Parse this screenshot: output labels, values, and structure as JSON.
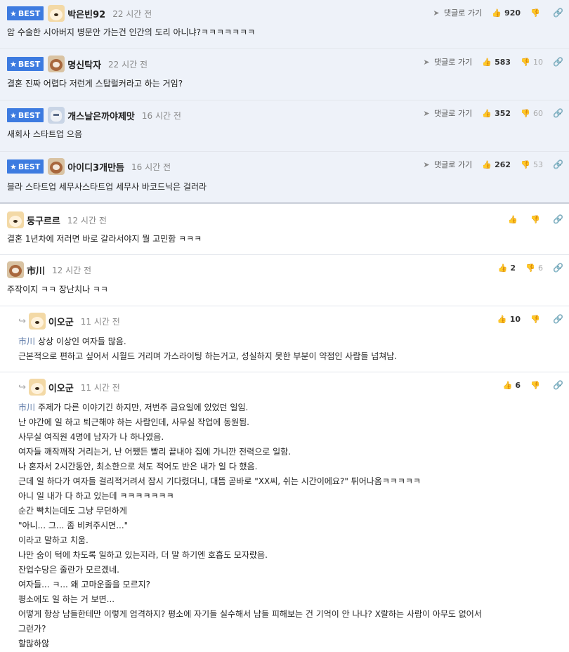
{
  "labels": {
    "best": "BEST",
    "goto_reply": "댓글로 가기"
  },
  "comments": [
    {
      "type": "best",
      "nickname": "박은빈92",
      "time": "22 시간 전",
      "text": "암 수술한 시아버지 병문안 가는건 인간의 도리 아니냐?ㅋㅋㅋㅋㅋㅋㅋ",
      "up": "920",
      "down": "",
      "avatar": "dog-icon"
    },
    {
      "type": "best",
      "nickname": "명신탁자",
      "time": "22 시간 전",
      "text": "결혼 진짜 어렵다 저런게 스탑럴커라고 하는 거임?",
      "up": "583",
      "down": "10",
      "avatar": "dog2-icon"
    },
    {
      "type": "best",
      "nickname": "개스날은까야제맛",
      "time": "16 시간 전",
      "text": "새회사 스타트업 으음",
      "up": "352",
      "down": "60",
      "avatar": "cat-icon"
    },
    {
      "type": "best",
      "nickname": "아이디3개만듬",
      "time": "16 시간 전",
      "text": "블라 스타트업 세무사스타트업 세무사 바코드닉은 걸러라",
      "up": "262",
      "down": "53",
      "avatar": "dog2-icon"
    },
    {
      "type": "normal",
      "nickname": "둥구르르",
      "time": "12 시간 전",
      "text": "결혼 1년차에 저러면 바로 갈라서야지 뭘 고민함 ㅋㅋㅋ",
      "up": "",
      "down": "",
      "avatar": "dog-icon"
    },
    {
      "type": "normal",
      "nickname": "市川",
      "time": "12 시간 전",
      "text": "주작이지 ㅋㅋ 장난치나 ㅋㅋ",
      "up": "2",
      "down": "6",
      "avatar": "dog2-icon"
    },
    {
      "type": "reply",
      "nickname": "이오군",
      "time": "11 시간 전",
      "mention": "市川",
      "text": "상상 이상인 여자들 많음.\n근본적으로 편하고 싶어서 시월드 거리며 가스라이팅 하는거고, 성실하지 못한 부분이 약점인 사람들 넘쳐남.",
      "up": "10",
      "down": "",
      "avatar": "dog-icon"
    },
    {
      "type": "reply",
      "nickname": "이오군",
      "time": "11 시간 전",
      "mention": "市川",
      "text": "주제가 다른 이야기긴 하지만, 저번주 금요일에 있었던 일임.\n난 야간에 일 하고 퇴근해야 하는 사람인데, 사무실 작업에 동원됨.\n사무실 여직원 4명에 남자가 나 하나였음.\n여자들 깨작깨작 거리는거, 난 어쨌든 빨리 끝내야 집에 가니깐 전력으로 일함.\n나 혼자서 2시간동안, 최소한으로 쳐도 적어도 반은 내가 일 다 했음.\n근데 일 하다가 여자들 걸리적거려서 잠시 기다렸더니, 대뜸 곧바로 \"XX씨, 쉬는 시간이에요?\" 튀어나옴ㅋㅋㅋㅋㅋ\n아니 일 내가 다 하고 있는데 ㅋㅋㅋㅋㅋㅋㅋ\n순간 빡치는데도 그냥 무던하게\n\"아니... 그... 좀 비켜주시면...\"\n이라고 말하고 치움.\n나만 숨이 턱에 차도록 일하고 있는지라, 더 말 하기엔 호흡도 모자랐음.\n잔업수당은 줄란가 모르겠네.\n여자들... ㅋ... 왜 고마운줄을 모르지?\n평소에도 일 하는 거 보면...\n어떻게 항상 남들한테만 이렇게 엄격하지? 평소에 자기들 실수해서 남들 피해보는 건 기억이 안 나나? X랄하는 사람이 아무도 없어서\n그런가?\n할많하않",
      "up": "6",
      "down": "",
      "avatar": "dog-icon"
    }
  ]
}
